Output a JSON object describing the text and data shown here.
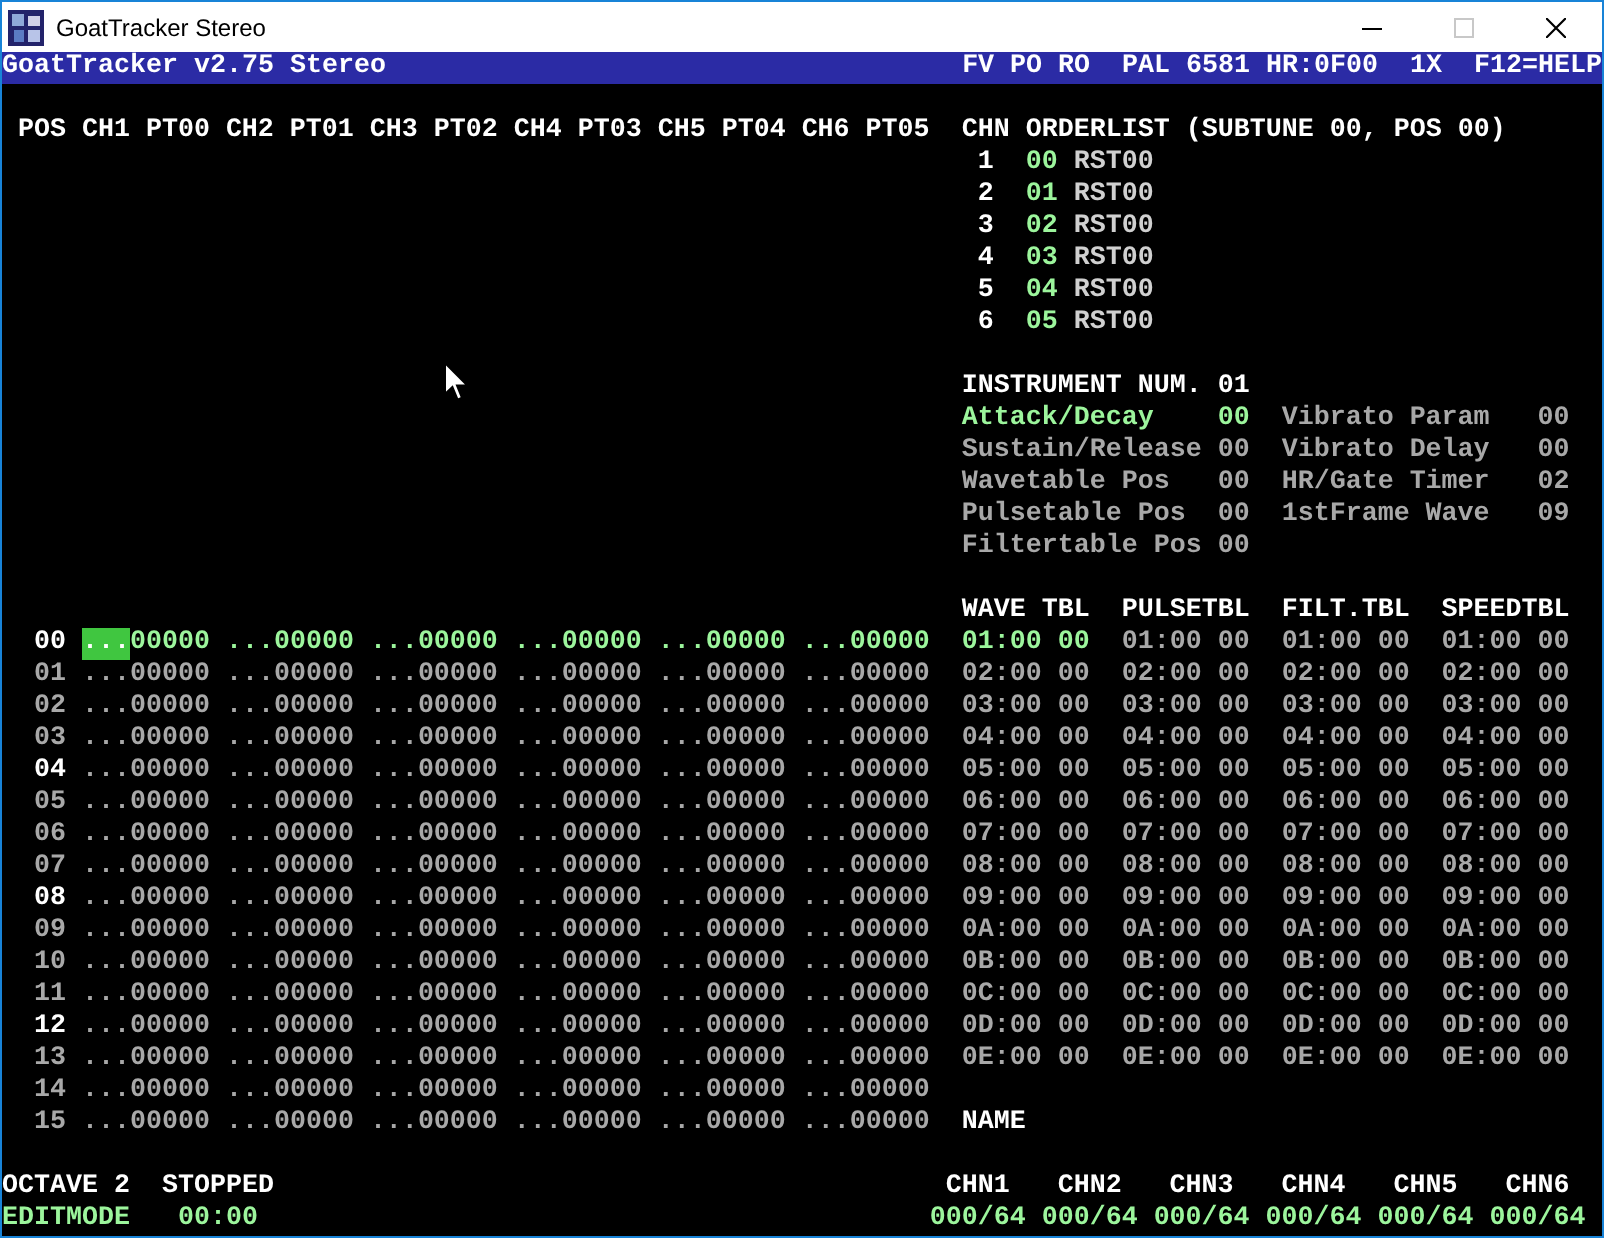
{
  "window": {
    "title": "GoatTracker Stereo",
    "buttons": [
      {
        "kind": "minimize",
        "disabled": false
      },
      {
        "kind": "maximize",
        "disabled": true
      },
      {
        "kind": "close",
        "disabled": false
      }
    ]
  },
  "header": {
    "title": "GoatTracker v2.75 Stereo",
    "flags": "FV PO RO",
    "sid": "PAL 6581 HR:0F00",
    "speed": "1X",
    "help": "F12=HELP"
  },
  "pattern": {
    "position_label": "POS",
    "channels": [
      {
        "label": "CH1",
        "pattern": "PT00"
      },
      {
        "label": "CH2",
        "pattern": "PT01"
      },
      {
        "label": "CH3",
        "pattern": "PT02"
      },
      {
        "label": "CH4",
        "pattern": "PT03"
      },
      {
        "label": "CH5",
        "pattern": "PT04"
      },
      {
        "label": "CH6",
        "pattern": "PT05"
      }
    ],
    "rows": [
      {
        "number": "00",
        "highlighted": true,
        "current": true,
        "cells": [
          {
            "note": "...",
            "data": "00000",
            "cursor": true
          },
          {
            "note": "...",
            "data": "00000",
            "cursor": false
          },
          {
            "note": "...",
            "data": "00000",
            "cursor": false
          },
          {
            "note": "...",
            "data": "00000",
            "cursor": false
          },
          {
            "note": "...",
            "data": "00000",
            "cursor": false
          },
          {
            "note": "...",
            "data": "00000",
            "cursor": false
          }
        ]
      },
      {
        "number": "01",
        "highlighted": false,
        "current": false,
        "cells": [
          {
            "note": "...",
            "data": "00000",
            "cursor": false
          },
          {
            "note": "...",
            "data": "00000",
            "cursor": false
          },
          {
            "note": "...",
            "data": "00000",
            "cursor": false
          },
          {
            "note": "...",
            "data": "00000",
            "cursor": false
          },
          {
            "note": "...",
            "data": "00000",
            "cursor": false
          },
          {
            "note": "...",
            "data": "00000",
            "cursor": false
          }
        ]
      },
      {
        "number": "02",
        "highlighted": false,
        "current": false,
        "cells": [
          {
            "note": "...",
            "data": "00000",
            "cursor": false
          },
          {
            "note": "...",
            "data": "00000",
            "cursor": false
          },
          {
            "note": "...",
            "data": "00000",
            "cursor": false
          },
          {
            "note": "...",
            "data": "00000",
            "cursor": false
          },
          {
            "note": "...",
            "data": "00000",
            "cursor": false
          },
          {
            "note": "...",
            "data": "00000",
            "cursor": false
          }
        ]
      },
      {
        "number": "03",
        "highlighted": false,
        "current": false,
        "cells": [
          {
            "note": "...",
            "data": "00000",
            "cursor": false
          },
          {
            "note": "...",
            "data": "00000",
            "cursor": false
          },
          {
            "note": "...",
            "data": "00000",
            "cursor": false
          },
          {
            "note": "...",
            "data": "00000",
            "cursor": false
          },
          {
            "note": "...",
            "data": "00000",
            "cursor": false
          },
          {
            "note": "...",
            "data": "00000",
            "cursor": false
          }
        ]
      },
      {
        "number": "04",
        "highlighted": true,
        "current": false,
        "cells": [
          {
            "note": "...",
            "data": "00000",
            "cursor": false
          },
          {
            "note": "...",
            "data": "00000",
            "cursor": false
          },
          {
            "note": "...",
            "data": "00000",
            "cursor": false
          },
          {
            "note": "...",
            "data": "00000",
            "cursor": false
          },
          {
            "note": "...",
            "data": "00000",
            "cursor": false
          },
          {
            "note": "...",
            "data": "00000",
            "cursor": false
          }
        ]
      },
      {
        "number": "05",
        "highlighted": false,
        "current": false,
        "cells": [
          {
            "note": "...",
            "data": "00000",
            "cursor": false
          },
          {
            "note": "...",
            "data": "00000",
            "cursor": false
          },
          {
            "note": "...",
            "data": "00000",
            "cursor": false
          },
          {
            "note": "...",
            "data": "00000",
            "cursor": false
          },
          {
            "note": "...",
            "data": "00000",
            "cursor": false
          },
          {
            "note": "...",
            "data": "00000",
            "cursor": false
          }
        ]
      },
      {
        "number": "06",
        "highlighted": false,
        "current": false,
        "cells": [
          {
            "note": "...",
            "data": "00000",
            "cursor": false
          },
          {
            "note": "...",
            "data": "00000",
            "cursor": false
          },
          {
            "note": "...",
            "data": "00000",
            "cursor": false
          },
          {
            "note": "...",
            "data": "00000",
            "cursor": false
          },
          {
            "note": "...",
            "data": "00000",
            "cursor": false
          },
          {
            "note": "...",
            "data": "00000",
            "cursor": false
          }
        ]
      },
      {
        "number": "07",
        "highlighted": false,
        "current": false,
        "cells": [
          {
            "note": "...",
            "data": "00000",
            "cursor": false
          },
          {
            "note": "...",
            "data": "00000",
            "cursor": false
          },
          {
            "note": "...",
            "data": "00000",
            "cursor": false
          },
          {
            "note": "...",
            "data": "00000",
            "cursor": false
          },
          {
            "note": "...",
            "data": "00000",
            "cursor": false
          },
          {
            "note": "...",
            "data": "00000",
            "cursor": false
          }
        ]
      },
      {
        "number": "08",
        "highlighted": true,
        "current": false,
        "cells": [
          {
            "note": "...",
            "data": "00000",
            "cursor": false
          },
          {
            "note": "...",
            "data": "00000",
            "cursor": false
          },
          {
            "note": "...",
            "data": "00000",
            "cursor": false
          },
          {
            "note": "...",
            "data": "00000",
            "cursor": false
          },
          {
            "note": "...",
            "data": "00000",
            "cursor": false
          },
          {
            "note": "...",
            "data": "00000",
            "cursor": false
          }
        ]
      },
      {
        "number": "09",
        "highlighted": false,
        "current": false,
        "cells": [
          {
            "note": "...",
            "data": "00000",
            "cursor": false
          },
          {
            "note": "...",
            "data": "00000",
            "cursor": false
          },
          {
            "note": "...",
            "data": "00000",
            "cursor": false
          },
          {
            "note": "...",
            "data": "00000",
            "cursor": false
          },
          {
            "note": "...",
            "data": "00000",
            "cursor": false
          },
          {
            "note": "...",
            "data": "00000",
            "cursor": false
          }
        ]
      },
      {
        "number": "10",
        "highlighted": false,
        "current": false,
        "cells": [
          {
            "note": "...",
            "data": "00000",
            "cursor": false
          },
          {
            "note": "...",
            "data": "00000",
            "cursor": false
          },
          {
            "note": "...",
            "data": "00000",
            "cursor": false
          },
          {
            "note": "...",
            "data": "00000",
            "cursor": false
          },
          {
            "note": "...",
            "data": "00000",
            "cursor": false
          },
          {
            "note": "...",
            "data": "00000",
            "cursor": false
          }
        ]
      },
      {
        "number": "11",
        "highlighted": false,
        "current": false,
        "cells": [
          {
            "note": "...",
            "data": "00000",
            "cursor": false
          },
          {
            "note": "...",
            "data": "00000",
            "cursor": false
          },
          {
            "note": "...",
            "data": "00000",
            "cursor": false
          },
          {
            "note": "...",
            "data": "00000",
            "cursor": false
          },
          {
            "note": "...",
            "data": "00000",
            "cursor": false
          },
          {
            "note": "...",
            "data": "00000",
            "cursor": false
          }
        ]
      },
      {
        "number": "12",
        "highlighted": true,
        "current": false,
        "cells": [
          {
            "note": "...",
            "data": "00000",
            "cursor": false
          },
          {
            "note": "...",
            "data": "00000",
            "cursor": false
          },
          {
            "note": "...",
            "data": "00000",
            "cursor": false
          },
          {
            "note": "...",
            "data": "00000",
            "cursor": false
          },
          {
            "note": "...",
            "data": "00000",
            "cursor": false
          },
          {
            "note": "...",
            "data": "00000",
            "cursor": false
          }
        ]
      },
      {
        "number": "13",
        "highlighted": false,
        "current": false,
        "cells": [
          {
            "note": "...",
            "data": "00000",
            "cursor": false
          },
          {
            "note": "...",
            "data": "00000",
            "cursor": false
          },
          {
            "note": "...",
            "data": "00000",
            "cursor": false
          },
          {
            "note": "...",
            "data": "00000",
            "cursor": false
          },
          {
            "note": "...",
            "data": "00000",
            "cursor": false
          },
          {
            "note": "...",
            "data": "00000",
            "cursor": false
          }
        ]
      },
      {
        "number": "14",
        "highlighted": false,
        "current": false,
        "cells": [
          {
            "note": "...",
            "data": "00000",
            "cursor": false
          },
          {
            "note": "...",
            "data": "00000",
            "cursor": false
          },
          {
            "note": "...",
            "data": "00000",
            "cursor": false
          },
          {
            "note": "...",
            "data": "00000",
            "cursor": false
          },
          {
            "note": "...",
            "data": "00000",
            "cursor": false
          },
          {
            "note": "...",
            "data": "00000",
            "cursor": false
          }
        ]
      },
      {
        "number": "15",
        "highlighted": false,
        "current": false,
        "cells": [
          {
            "note": "...",
            "data": "00000",
            "cursor": false
          },
          {
            "note": "...",
            "data": "00000",
            "cursor": false
          },
          {
            "note": "...",
            "data": "00000",
            "cursor": false
          },
          {
            "note": "...",
            "data": "00000",
            "cursor": false
          },
          {
            "note": "...",
            "data": "00000",
            "cursor": false
          },
          {
            "note": "...",
            "data": "00000",
            "cursor": false
          }
        ]
      }
    ]
  },
  "orderlist": {
    "label": "CHN",
    "title": "ORDERLIST (SUBTUNE 00, POS 00)",
    "entries": [
      {
        "channel": "1",
        "pattern": "00",
        "command": "RST00"
      },
      {
        "channel": "2",
        "pattern": "01",
        "command": "RST00"
      },
      {
        "channel": "3",
        "pattern": "02",
        "command": "RST00"
      },
      {
        "channel": "4",
        "pattern": "03",
        "command": "RST00"
      },
      {
        "channel": "5",
        "pattern": "04",
        "command": "RST00"
      },
      {
        "channel": "6",
        "pattern": "05",
        "command": "RST00"
      }
    ]
  },
  "instrument": {
    "title": "INSTRUMENT NUM. 01",
    "params_left": [
      {
        "label": "Attack/Decay",
        "value": "00",
        "selected": true
      },
      {
        "label": "Sustain/Release",
        "value": "00",
        "selected": false
      },
      {
        "label": "Wavetable Pos",
        "value": "00",
        "selected": false
      },
      {
        "label": "Pulsetable Pos",
        "value": "00",
        "selected": false
      },
      {
        "label": "Filtertable Pos",
        "value": "00",
        "selected": false
      }
    ],
    "params_right": [
      {
        "label": "Vibrato Param",
        "value": "00",
        "selected": false
      },
      {
        "label": "Vibrato Delay",
        "value": "00",
        "selected": false
      },
      {
        "label": "HR/Gate Timer",
        "value": "02",
        "selected": false
      },
      {
        "label": "1stFrame Wave",
        "value": "09",
        "selected": false
      }
    ]
  },
  "tables": [
    {
      "title": "WAVE TBL",
      "rows": [
        {
          "text": "01:00 00",
          "selected": true
        },
        {
          "text": "02:00 00",
          "selected": false
        },
        {
          "text": "03:00 00",
          "selected": false
        },
        {
          "text": "04:00 00",
          "selected": false
        },
        {
          "text": "05:00 00",
          "selected": false
        },
        {
          "text": "06:00 00",
          "selected": false
        },
        {
          "text": "07:00 00",
          "selected": false
        },
        {
          "text": "08:00 00",
          "selected": false
        },
        {
          "text": "09:00 00",
          "selected": false
        },
        {
          "text": "0A:00 00",
          "selected": false
        },
        {
          "text": "0B:00 00",
          "selected": false
        },
        {
          "text": "0C:00 00",
          "selected": false
        },
        {
          "text": "0D:00 00",
          "selected": false
        },
        {
          "text": "0E:00 00",
          "selected": false
        }
      ]
    },
    {
      "title": "PULSETBL",
      "rows": [
        {
          "text": "01:00 00",
          "selected": false
        },
        {
          "text": "02:00 00",
          "selected": false
        },
        {
          "text": "03:00 00",
          "selected": false
        },
        {
          "text": "04:00 00",
          "selected": false
        },
        {
          "text": "05:00 00",
          "selected": false
        },
        {
          "text": "06:00 00",
          "selected": false
        },
        {
          "text": "07:00 00",
          "selected": false
        },
        {
          "text": "08:00 00",
          "selected": false
        },
        {
          "text": "09:00 00",
          "selected": false
        },
        {
          "text": "0A:00 00",
          "selected": false
        },
        {
          "text": "0B:00 00",
          "selected": false
        },
        {
          "text": "0C:00 00",
          "selected": false
        },
        {
          "text": "0D:00 00",
          "selected": false
        },
        {
          "text": "0E:00 00",
          "selected": false
        }
      ]
    },
    {
      "title": "FILT.TBL",
      "rows": [
        {
          "text": "01:00 00",
          "selected": false
        },
        {
          "text": "02:00 00",
          "selected": false
        },
        {
          "text": "03:00 00",
          "selected": false
        },
        {
          "text": "04:00 00",
          "selected": false
        },
        {
          "text": "05:00 00",
          "selected": false
        },
        {
          "text": "06:00 00",
          "selected": false
        },
        {
          "text": "07:00 00",
          "selected": false
        },
        {
          "text": "08:00 00",
          "selected": false
        },
        {
          "text": "09:00 00",
          "selected": false
        },
        {
          "text": "0A:00 00",
          "selected": false
        },
        {
          "text": "0B:00 00",
          "selected": false
        },
        {
          "text": "0C:00 00",
          "selected": false
        },
        {
          "text": "0D:00 00",
          "selected": false
        },
        {
          "text": "0E:00 00",
          "selected": false
        }
      ]
    },
    {
      "title": "SPEEDTBL",
      "rows": [
        {
          "text": "01:00 00",
          "selected": false
        },
        {
          "text": "02:00 00",
          "selected": false
        },
        {
          "text": "03:00 00",
          "selected": false
        },
        {
          "text": "04:00 00",
          "selected": false
        },
        {
          "text": "05:00 00",
          "selected": false
        },
        {
          "text": "06:00 00",
          "selected": false
        },
        {
          "text": "07:00 00",
          "selected": false
        },
        {
          "text": "08:00 00",
          "selected": false
        },
        {
          "text": "09:00 00",
          "selected": false
        },
        {
          "text": "0A:00 00",
          "selected": false
        },
        {
          "text": "0B:00 00",
          "selected": false
        },
        {
          "text": "0C:00 00",
          "selected": false
        },
        {
          "text": "0D:00 00",
          "selected": false
        },
        {
          "text": "0E:00 00",
          "selected": false
        }
      ]
    }
  ],
  "name": {
    "label": "NAME"
  },
  "status": {
    "octave": "OCTAVE 2",
    "state": "STOPPED",
    "mode": "EDITMODE",
    "time": "00:00",
    "channels": [
      {
        "label": "CHN1",
        "position": "000/64"
      },
      {
        "label": "CHN2",
        "position": "000/64"
      },
      {
        "label": "CHN3",
        "position": "000/64"
      },
      {
        "label": "CHN4",
        "position": "000/64"
      },
      {
        "label": "CHN5",
        "position": "000/64"
      },
      {
        "label": "CHN6",
        "position": "000/64"
      }
    ]
  }
}
